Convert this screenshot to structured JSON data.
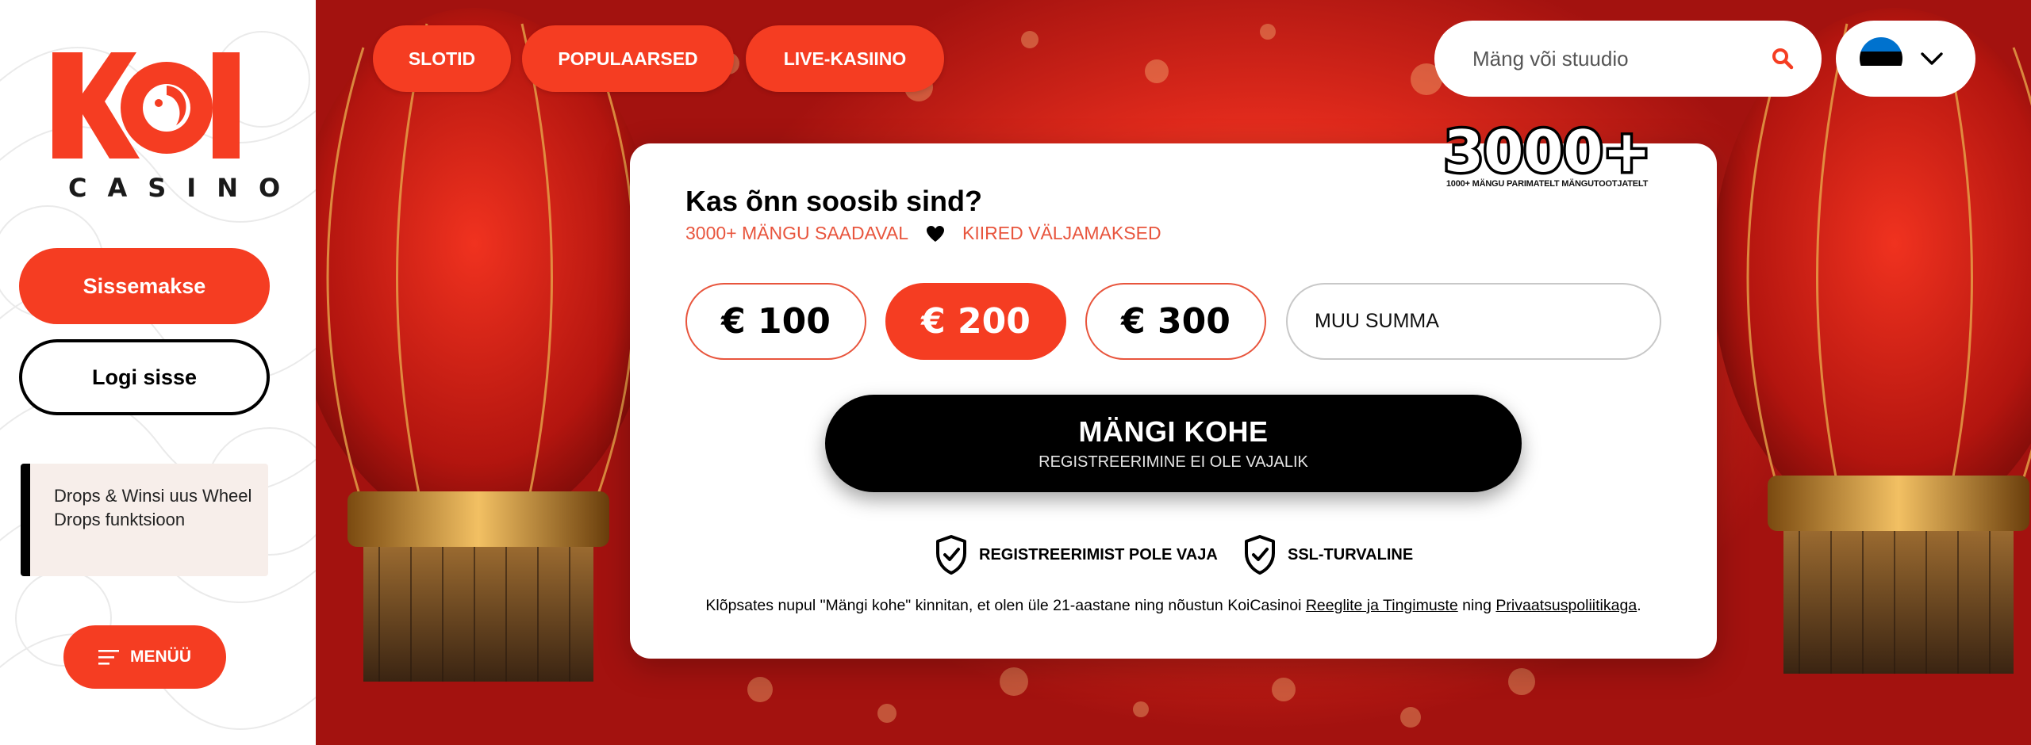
{
  "sidebar": {
    "logo_text": "KOI",
    "logo_sub": "CASINO",
    "deposit_label": "Sissemakse",
    "login_label": "Logi sisse",
    "promo_text": "Drops & Winsi uus Wheel Drops funktsioon",
    "menu_label": "MENÜÜ",
    "menu_icon": "hamburger-icon"
  },
  "nav": {
    "items": [
      {
        "label": "SLOTID"
      },
      {
        "label": "POPULAARSED"
      },
      {
        "label": "LIVE-KASIINO"
      }
    ]
  },
  "search": {
    "placeholder": "Mäng või stuudio",
    "icon": "search-icon"
  },
  "language": {
    "flag": "estonia-flag-icon",
    "flag_colors": [
      "#0072CE",
      "#000000",
      "#FFFFFF"
    ],
    "chevron": "chevron-down-icon"
  },
  "badge": {
    "title": "3000+",
    "subtitle": "1000+ MÄNGU PARIMATELT MÄNGUTOOTJATELT"
  },
  "card": {
    "title": "Kas õnn soosib sind?",
    "sub_left": "3000+ MÄNGU SAADAVAL",
    "sub_right": "KIIRED VÄLJAMAKSED",
    "amounts": [
      "€ 100",
      "€ 200",
      "€ 300"
    ],
    "selected_amount": "€ 200",
    "other_placeholder": "MUU SUMMA",
    "play_label": "MÄNGI KOHE",
    "play_sub": "REGISTREERIMINE EI OLE VAJALIK",
    "trust_1": "REGISTREERIMIST POLE VAJA",
    "trust_2": "SSL-TURVALINE",
    "legal_prefix": "Klõpsates nupul \"Mängi kohe\" kinnitan, et olen üle 21-aastane ning nõustun KoiCasinoi",
    "legal_link_1": "Reeglite ja Tingimuste",
    "legal_mid": "ning",
    "legal_link_2": "Privaatsuspoliitikaga",
    "legal_suffix": "."
  },
  "colors": {
    "accent": "#F53D22",
    "accent_text": "#E8553D",
    "dark": "#000000",
    "promo_bg": "#F7EEEA"
  }
}
